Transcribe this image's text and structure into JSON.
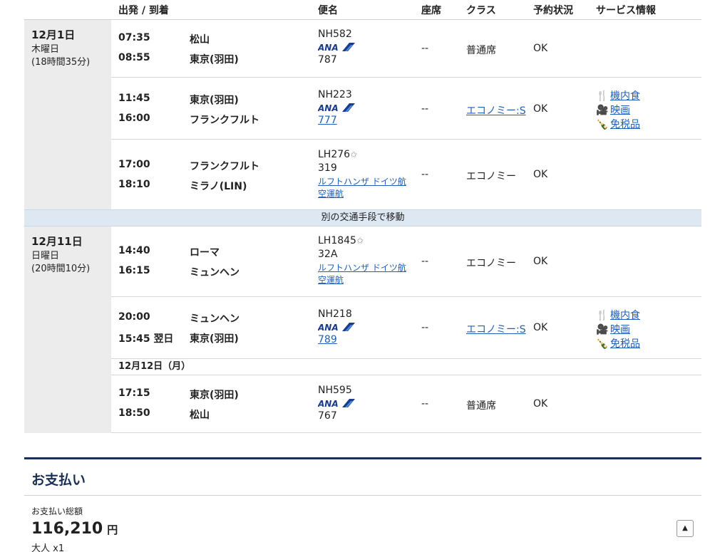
{
  "header": {
    "dep_arr": "出発 / 到着",
    "flight": "便名",
    "seat": "座席",
    "class": "クラス",
    "status": "予約状況",
    "service": "サービス情報"
  },
  "days": [
    {
      "date": "12月1日",
      "weekday": "木曜日",
      "duration": "(18時間35分)",
      "segments": [
        {
          "dep_time": "07:35",
          "dep_ap": "松山",
          "arr_time": "08:55",
          "arr_ap": "東京(羽田)",
          "flight_no": "NH582",
          "airline_logo": "ANA",
          "aircraft": "787",
          "seat": "--",
          "class": "普通席",
          "status": "OK"
        },
        {
          "dep_time": "11:45",
          "dep_ap": "東京(羽田)",
          "arr_time": "16:00",
          "arr_ap": "フランクフルト",
          "flight_no": "NH223",
          "airline_logo": "ANA",
          "aircraft": "777",
          "seat": "--",
          "class": "エコノミー:S",
          "status": "OK",
          "services": [
            "機内食",
            "映画",
            "免税品"
          ]
        },
        {
          "dep_time": "17:00",
          "dep_ap": "フランクフルト",
          "arr_time": "18:10",
          "arr_ap": "ミラノ(LIN)",
          "flight_no": "LH276",
          "aircraft": "319",
          "operator": "ルフトハンザ ドイツ航空運航",
          "seat": "--",
          "class": "エコノミー",
          "status": "OK"
        }
      ]
    },
    {
      "date": "12月11日",
      "weekday": "日曜日",
      "duration": "(20時間10分)",
      "segments": [
        {
          "dep_time": "14:40",
          "dep_ap": "ローマ",
          "arr_time": "16:15",
          "arr_ap": "ミュンヘン",
          "flight_no": "LH1845",
          "aircraft": "32A",
          "operator": "ルフトハンザ ドイツ航空運航",
          "seat": "--",
          "class": "エコノミー",
          "status": "OK"
        },
        {
          "dep_time": "20:00",
          "dep_ap": "ミュンヘン",
          "arr_time": "15:45 翌日",
          "arr_ap": "東京(羽田)",
          "flight_no": "NH218",
          "airline_logo": "ANA",
          "aircraft": "789",
          "seat": "--",
          "class": "エコノミー:S",
          "status": "OK",
          "services": [
            "機内食",
            "映画",
            "免税品"
          ]
        },
        {
          "dep_time": "17:15",
          "dep_ap": "東京(羽田)",
          "arr_time": "18:50",
          "arr_ap": "松山",
          "flight_no": "NH595",
          "airline_logo": "ANA",
          "aircraft": "767",
          "seat": "--",
          "class": "普通席",
          "status": "OK"
        }
      ]
    }
  ],
  "transfer_note": "別の交通手段で移動",
  "subdate": "12月12日（月）",
  "payment": {
    "title": "お支払い",
    "total_label": "お支払い総額",
    "amount": "116,210",
    "currency": "円",
    "passengers": "大人 x1"
  },
  "icons": {
    "meal": "fork-knife-icon",
    "movie": "film-camera-icon",
    "dutyfree": "bottle-icon",
    "partner_star": "star-icon",
    "collapse": "caret-up-icon"
  },
  "colors": {
    "link": "#1f5fb8",
    "ana_blue": "#1a3a8c",
    "transfer_bg": "#dde8f3",
    "payment_border": "#1a2f55"
  }
}
